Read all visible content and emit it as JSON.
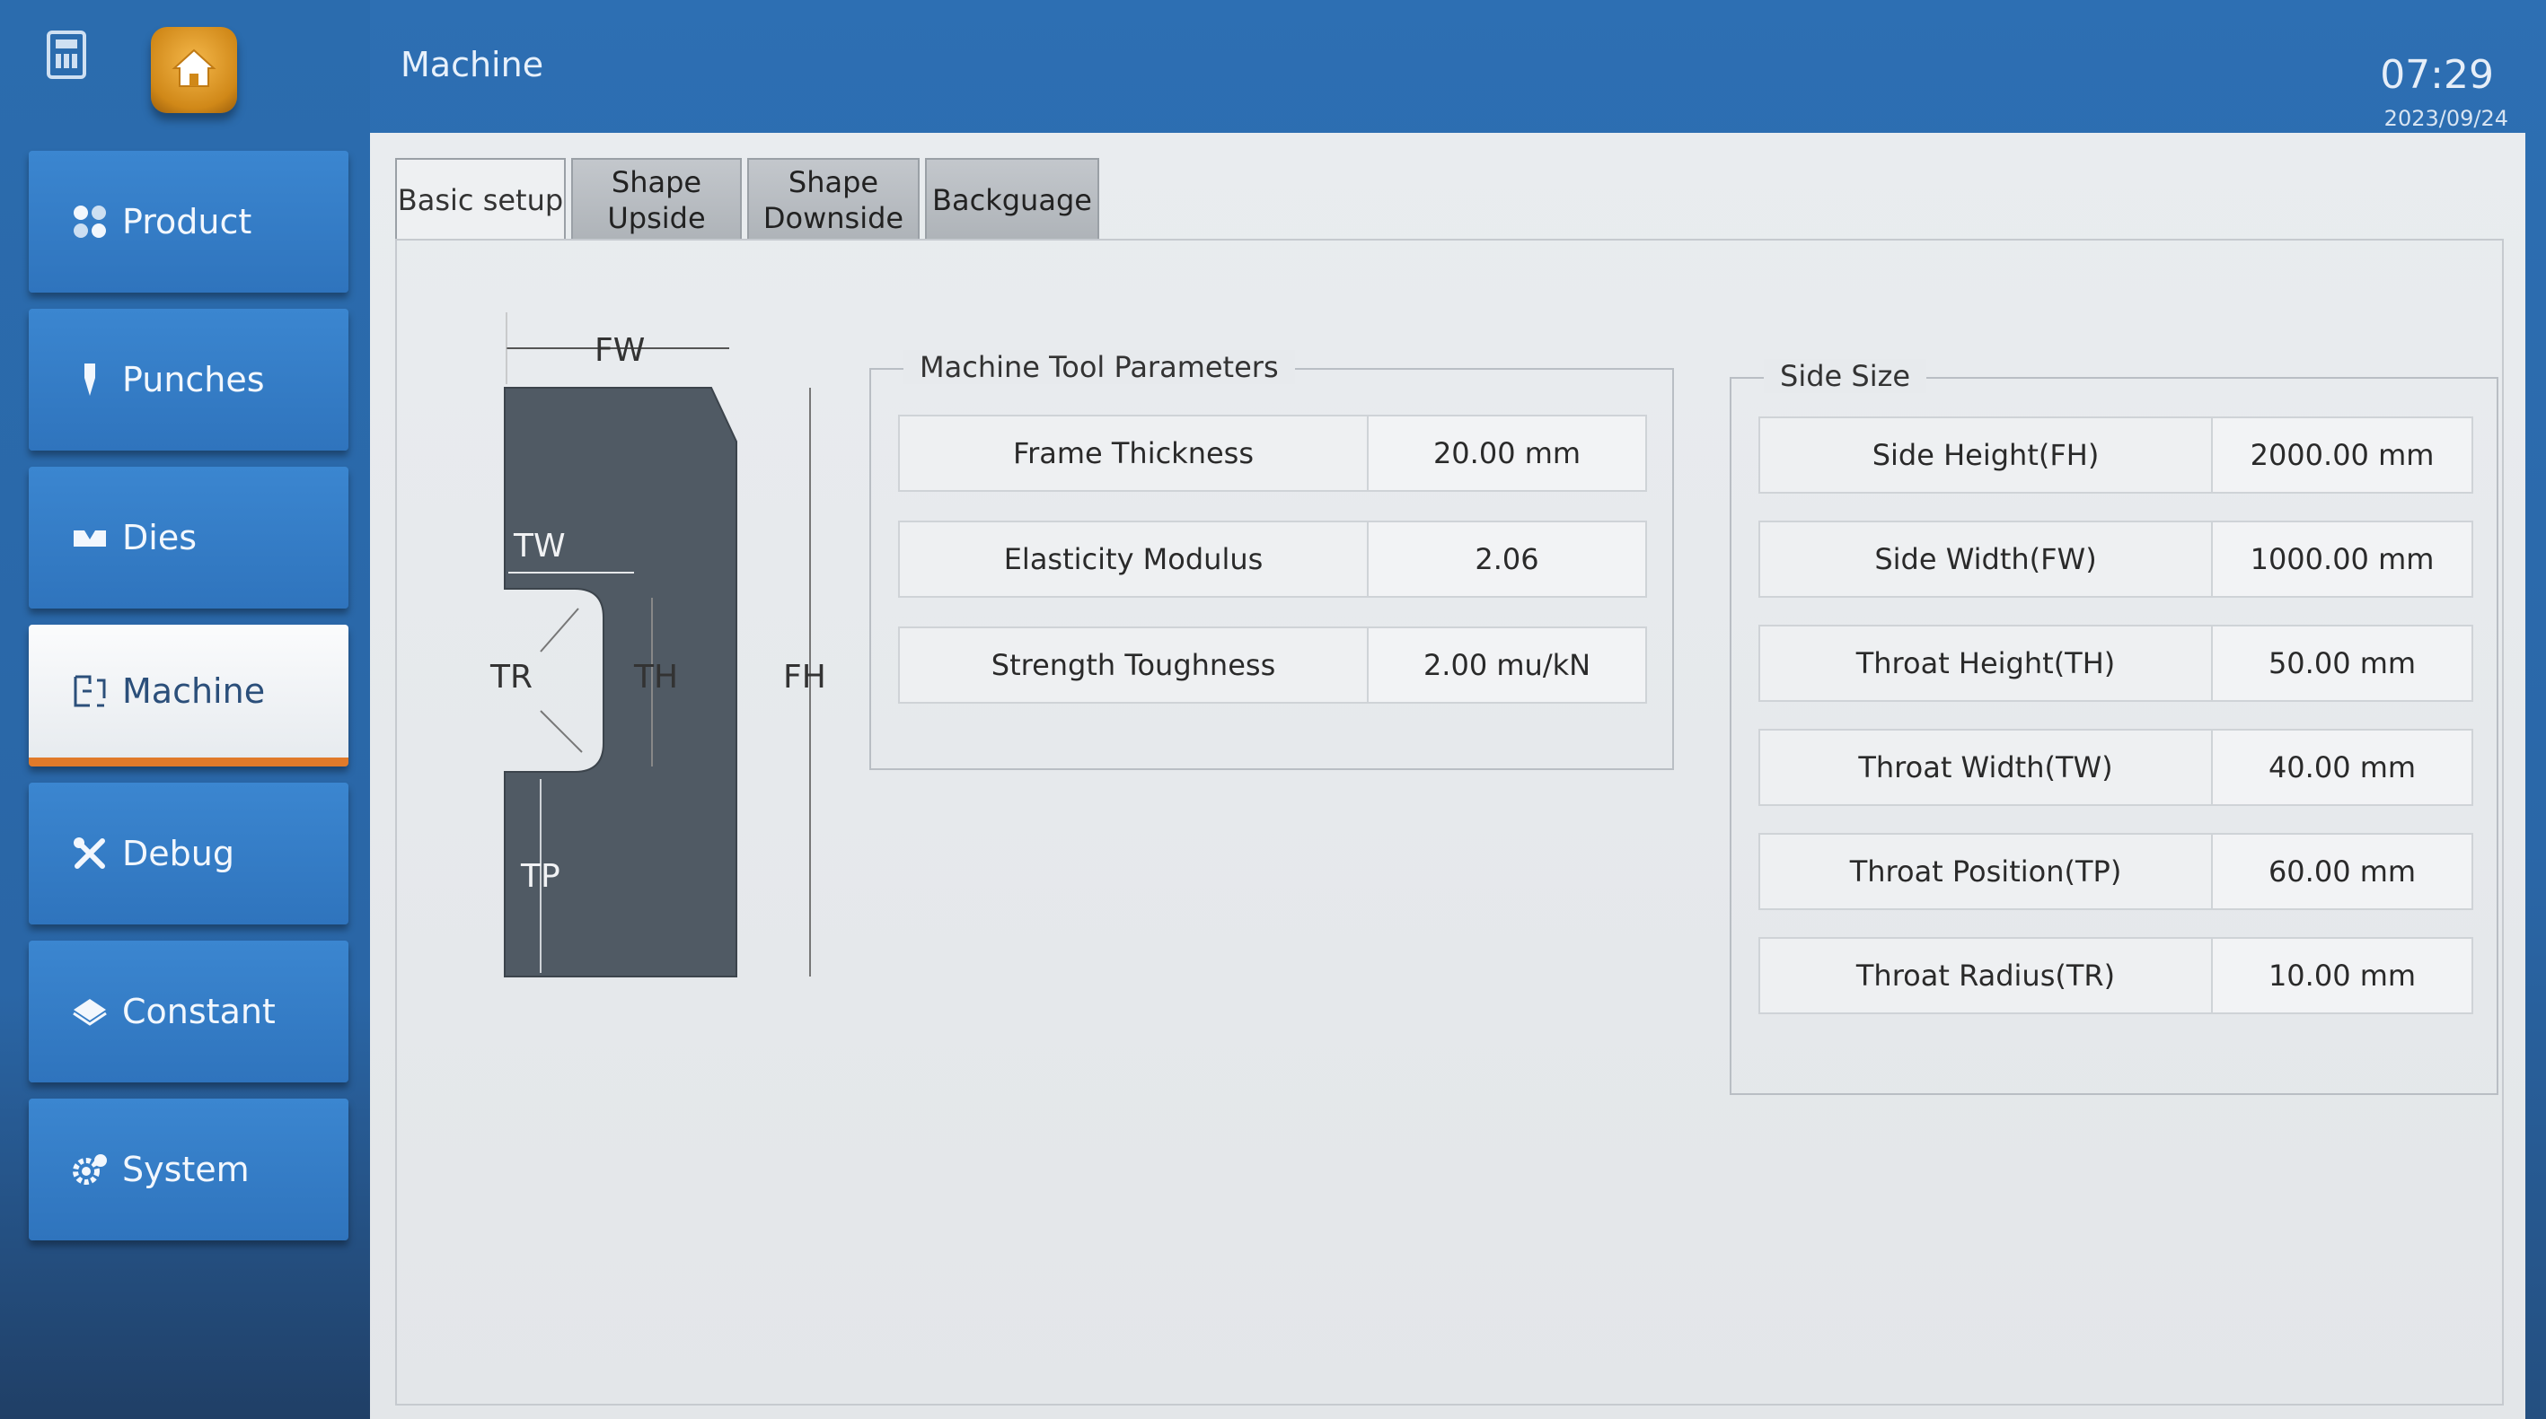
{
  "header": {
    "title": "Machine",
    "time": "07:29",
    "date": "2023/09/24"
  },
  "sidebar": {
    "items": [
      {
        "label": "Product",
        "icon": "product-icon",
        "active": false
      },
      {
        "label": "Punches",
        "icon": "punch-icon",
        "active": false
      },
      {
        "label": "Dies",
        "icon": "die-icon",
        "active": false
      },
      {
        "label": "Machine",
        "icon": "machine-icon",
        "active": true
      },
      {
        "label": "Debug",
        "icon": "tools-icon",
        "active": false
      },
      {
        "label": "Constant",
        "icon": "diamond-icon",
        "active": false
      },
      {
        "label": "System",
        "icon": "system-gear-icon",
        "active": false
      }
    ]
  },
  "tabs": [
    {
      "label": "Basic setup",
      "active": true
    },
    {
      "label": "Shape Upside",
      "active": false
    },
    {
      "label": "Shape Downside",
      "active": false
    },
    {
      "label": "Backguage",
      "active": false
    }
  ],
  "diagram": {
    "labels": {
      "fw": "FW",
      "tw": "TW",
      "tr": "TR",
      "th": "TH",
      "fh": "FH",
      "tp": "TP"
    }
  },
  "machine_tool_parameters": {
    "title": "Machine Tool Parameters",
    "rows": [
      {
        "label": "Frame Thickness",
        "value": "20.00 mm"
      },
      {
        "label": "Elasticity Modulus",
        "value": "2.06"
      },
      {
        "label": "Strength Toughness",
        "value": "2.00 mu/kN"
      }
    ]
  },
  "side_size": {
    "title": "Side Size",
    "rows": [
      {
        "label": "Side Height(FH)",
        "value": "2000.00 mm"
      },
      {
        "label": "Side Width(FW)",
        "value": "1000.00 mm"
      },
      {
        "label": "Throat Height(TH)",
        "value": "50.00 mm"
      },
      {
        "label": "Throat Width(TW)",
        "value": "40.00 mm"
      },
      {
        "label": "Throat Position(TP)",
        "value": "60.00 mm"
      },
      {
        "label": "Throat Radius(TR)",
        "value": "10.00 mm"
      }
    ]
  },
  "colors": {
    "header_blue": "#2d6fb3",
    "active_underline": "#e07a2a",
    "panel": "#e7eaed"
  }
}
